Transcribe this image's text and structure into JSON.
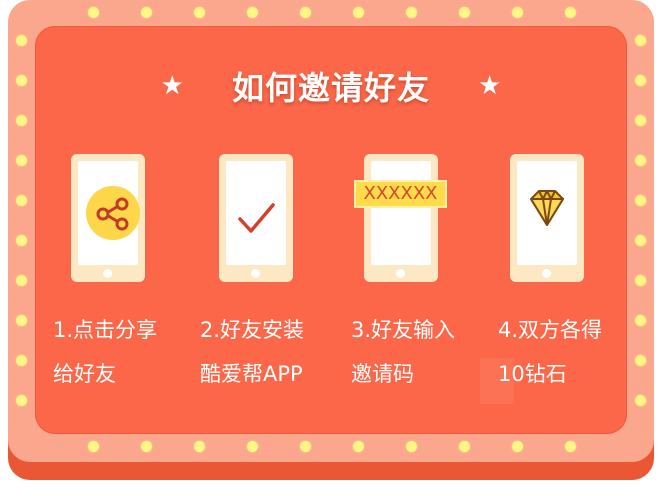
{
  "title": "如何邀请好友",
  "star_glyph": "★",
  "steps": [
    {
      "line1": "1.点击分享",
      "line2": "给好友",
      "icon": "share-icon"
    },
    {
      "line1": "2.好友安装",
      "line2": "酷爱帮APP",
      "icon": "checkmark-icon"
    },
    {
      "line1": "3.好友输入",
      "line2": "邀请码",
      "icon": "code-input-icon",
      "code": "XXXXXX"
    },
    {
      "line1": "4.双方各得",
      "line2": "10钻石",
      "icon": "diamond-icon"
    }
  ],
  "colors": {
    "frame": "#fba78e",
    "panel": "#fb6748",
    "bulb": "#fff685",
    "phone": "#fde8c4",
    "accent_yellow": "#fdd64a",
    "check_red": "#d5402a"
  }
}
